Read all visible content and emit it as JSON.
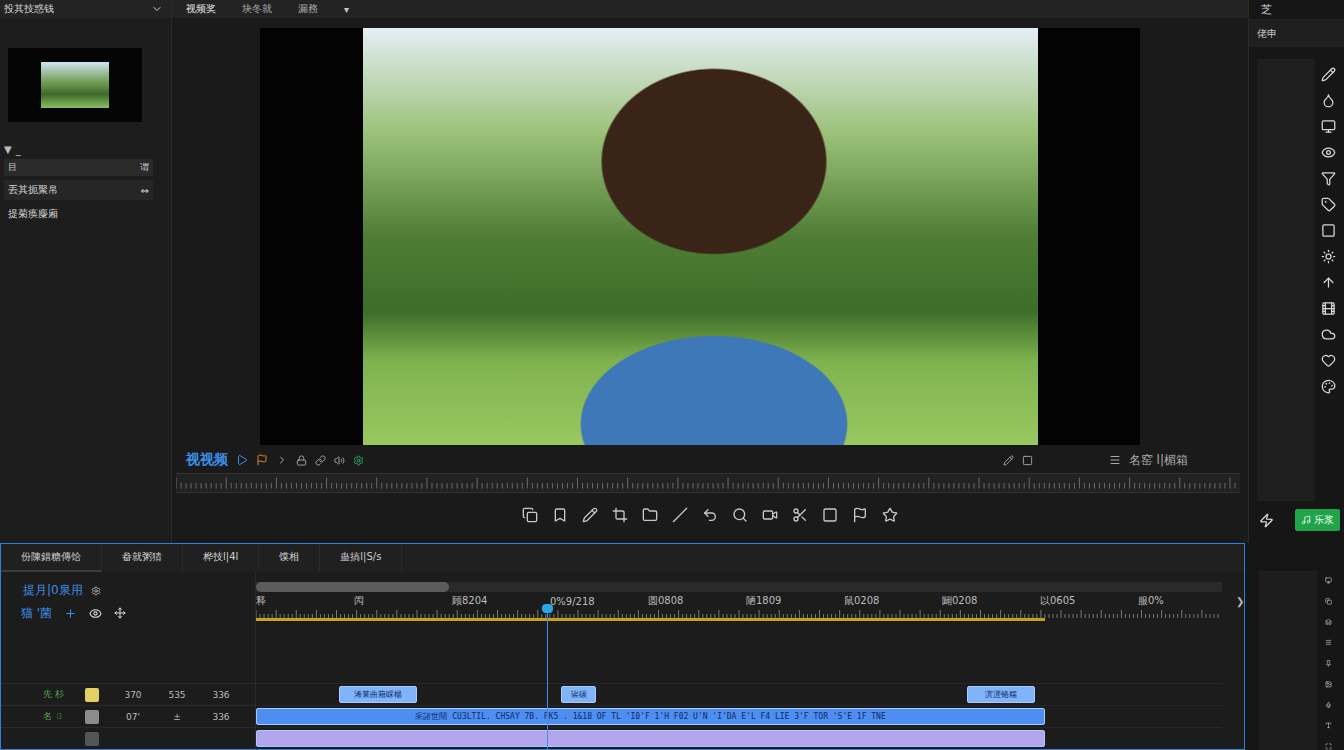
{
  "left_panel": {
    "title": "投其技惑钱",
    "folder_toggle": "▼",
    "folder_label": "_",
    "list_header": {
      "icon": "目",
      "action": "谓"
    },
    "items": [
      {
        "label": "丟其扼聚帛",
        "badge": "⇔",
        "selected": true
      },
      {
        "label": "提菊痪麋廂",
        "selected": false
      }
    ]
  },
  "center_tabs": [
    {
      "label": "视频奖",
      "selected": true
    },
    {
      "label": "块冬就",
      "selected": false
    },
    {
      "label": "漏務",
      "selected": false
    }
  ],
  "center_dropdown": "▾",
  "preview": {
    "label": "视视频",
    "right_label": "名窑 l|楣箱"
  },
  "right_panel": {
    "title": "芝",
    "subtitle": "佬申",
    "button": "乐浆"
  },
  "timeline": {
    "tabs": [
      {
        "label": "份陳錯糖傳饸",
        "selected": true
      },
      {
        "label": "畚就粥猜",
        "selected": false
      },
      {
        "label": "桦技l|4l",
        "selected": false
      },
      {
        "label": "馍相",
        "selected": false
      },
      {
        "label": "蛊搞l|S/s",
        "selected": false
      }
    ],
    "header": "提月|0泉用",
    "sub_header": "猫 '菌",
    "scrollbar": {
      "level": 0.2
    },
    "ruler": [
      "释",
      "闶",
      "顾8204",
      "0%9/218",
      "圆0808",
      "陋1809",
      "鼠0208",
      "闢0208",
      "以0605",
      "服0%"
    ],
    "ruler_end": "❯",
    "work_area": {
      "level": 0.817
    },
    "playhead": {
      "level": 0.295
    },
    "tracks": [
      {
        "name": "先 杉",
        "color": "#e6cf62",
        "values": [
          "370",
          "535",
          "336"
        ],
        "clips": [
          {
            "label": "浠莱曲藉睬楊",
            "start": 0.086,
            "end": 0.167,
            "color": "#7fb4fa"
          },
          {
            "label": "诶碳",
            "start": 0.316,
            "end": 0.352,
            "color": "#7fb4fa"
          },
          {
            "label": "滨涯铬糯",
            "start": 0.736,
            "end": 0.806,
            "color": "#7fb4fa"
          }
        ]
      },
      {
        "name": "名 ㄖ",
        "color": "#8c8c8c",
        "values": [
          "07'",
          "±",
          "336"
        ],
        "clips": [
          {
            "label": "采諸世鬧 CU3LTIL. CHSAY 7B. FK5 . 1&18 OF TL 'I0'F 1'H F02 U'N 'I'DA E'L F4 LIE 3'F TOR 'S'E 1F TNE",
            "start": 0,
            "end": 0.817,
            "color": "#4d8ef0"
          }
        ]
      },
      {
        "name": "",
        "color": "#555555",
        "values": [],
        "clips": [
          {
            "label": "",
            "start": 0,
            "end": 0.817,
            "color": "#b4a6ee"
          }
        ]
      }
    ]
  }
}
